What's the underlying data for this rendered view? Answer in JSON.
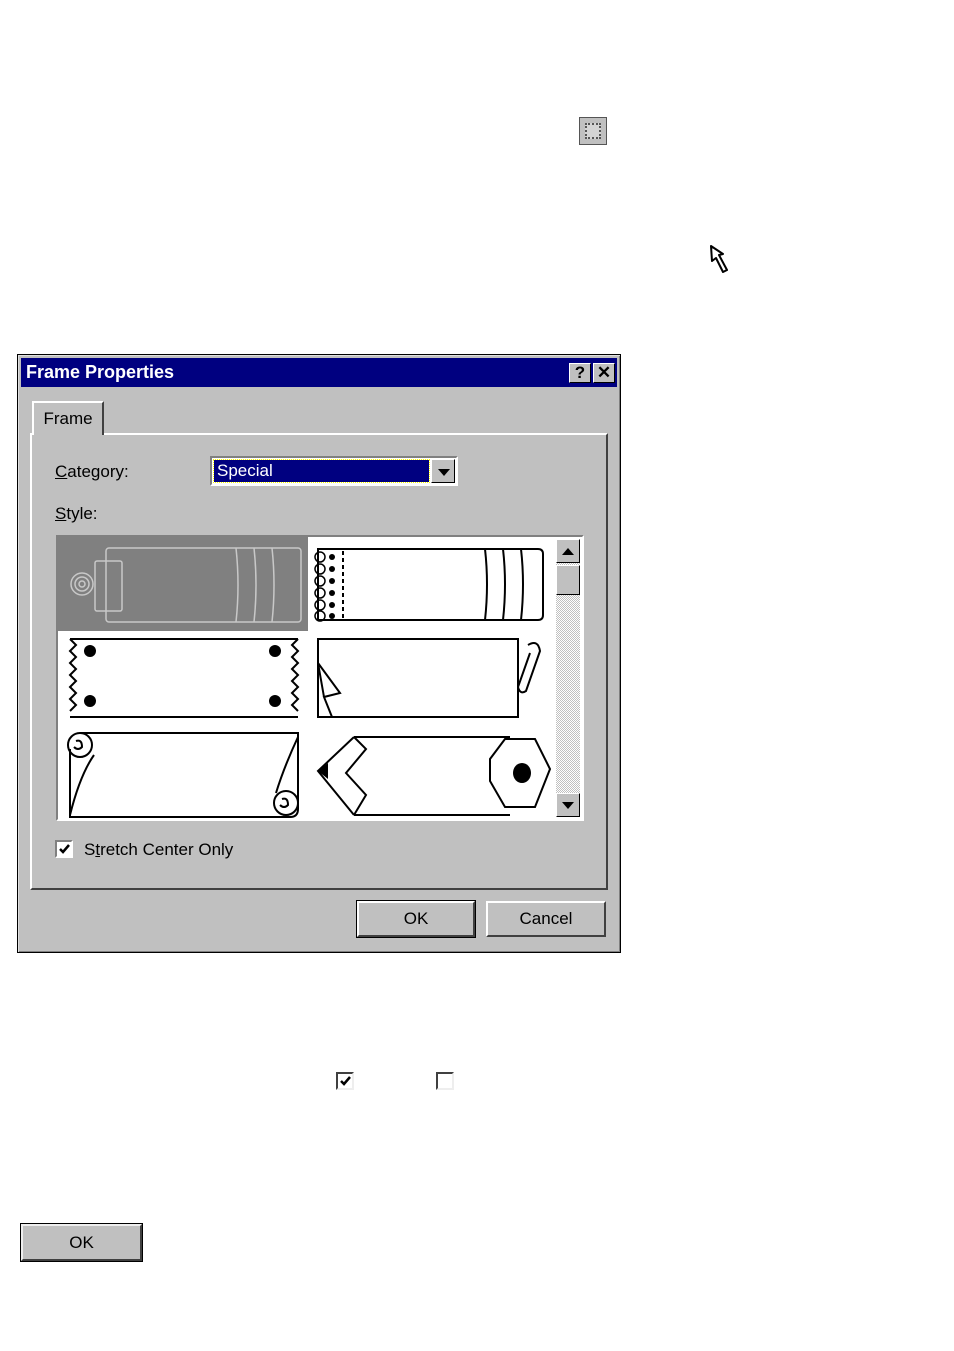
{
  "standalone_icons": {
    "frame_tool_icon": "frame-tool-icon",
    "pointer_cursor_icon": "arrow-cursor-icon",
    "checked_checkbox_sample": "checked-checkbox",
    "unchecked_checkbox_sample": "unchecked-checkbox"
  },
  "dialog": {
    "title": "Frame Properties",
    "help_button": "?",
    "close_button": "✕",
    "tabs": [
      {
        "label": "Frame",
        "active": true
      }
    ],
    "category_label_mnemonic": "C",
    "category_label_rest": "ategory:",
    "category_value": "Special",
    "style_label_mnemonic": "S",
    "style_label_rest": "tyle:",
    "styles": [
      {
        "name": "clipboard-tabs",
        "selected": true
      },
      {
        "name": "spiral-notebook",
        "selected": false
      },
      {
        "name": "torn-edges-pins",
        "selected": false
      },
      {
        "name": "paperclip-curl",
        "selected": false
      },
      {
        "name": "scroll",
        "selected": false
      },
      {
        "name": "pencil",
        "selected": false
      }
    ],
    "stretch_checkbox": {
      "label_pre": "S",
      "label_mnemonic": "t",
      "label_rest": "retch Center Only",
      "checked": true
    },
    "ok_label": "OK",
    "cancel_label": "Cancel"
  },
  "standalone_ok_label": "OK",
  "colors": {
    "titlebar": "#000080",
    "dialog_bg": "#c0c0c0",
    "selection": "#000080"
  }
}
